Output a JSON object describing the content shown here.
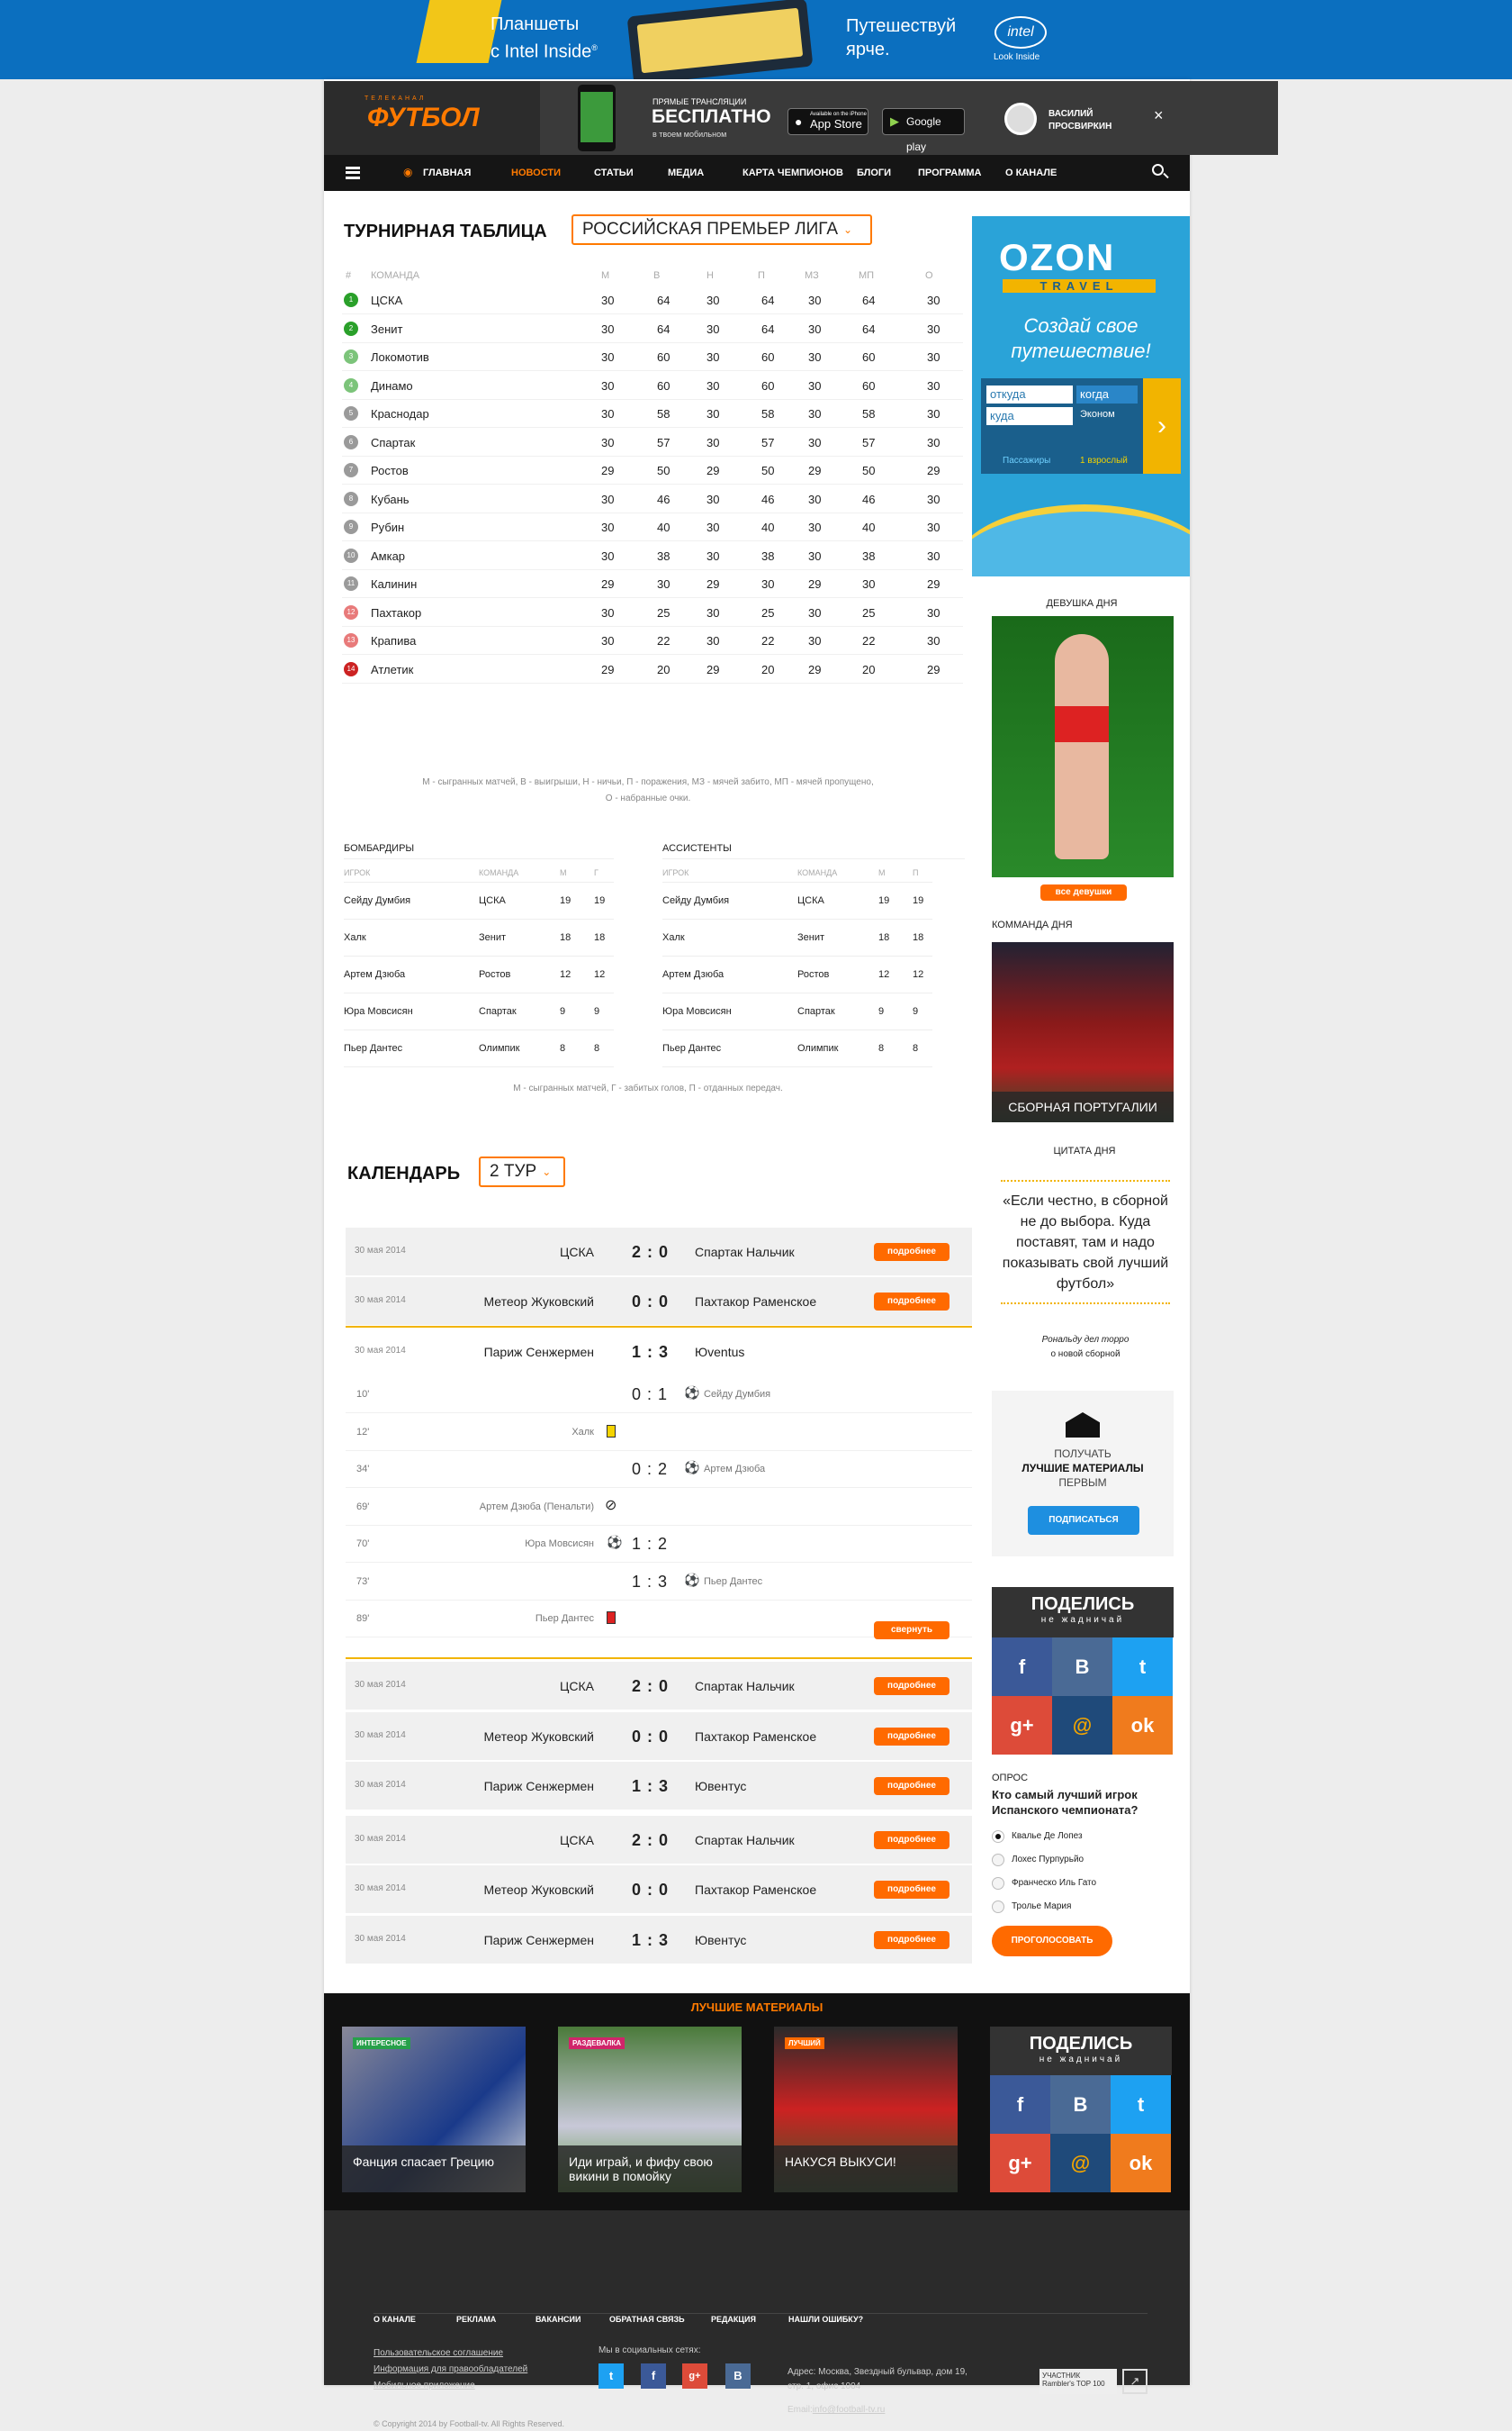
{
  "top_banner": {
    "line1": "Планшеты",
    "line2": "с Intel Inside",
    "slogan1": "Путешествуй",
    "slogan2": "ярче.",
    "brand": "intel",
    "brand_sub": "Look Inside"
  },
  "mobile_banner": {
    "logo_top": "ТЕЛЕКАНАЛ",
    "logo": "ФУТБОЛ",
    "line1": "ПРЯМЫЕ ТРАНСЛЯЦИИ",
    "line2": "БЕСПЛАТНО",
    "line3": "в твоем мобильном",
    "appstore_small": "Available on the iPhone",
    "appstore": "App Store",
    "gplay": "Google play",
    "user_first": "ВАСИЛИЙ",
    "user_last": "ПРОСВИРКИН"
  },
  "nav": {
    "items": [
      "ГЛАВНАЯ",
      "НОВОСТИ",
      "СТАТЬИ",
      "МЕДИА",
      "КАРТА ЧЕМПИОНОВ",
      "БЛОГИ",
      "ПРОГРАММА",
      "О КАНАЛЕ"
    ],
    "active": 1
  },
  "standings": {
    "title": "ТУРНИРНАЯ ТАБЛИЦА",
    "league": "РОССИЙСКАЯ ПРЕМЬЕР ЛИГА",
    "headers": [
      "#",
      "КОМАНДА",
      "М",
      "В",
      "Н",
      "П",
      "МЗ",
      "МП",
      "О"
    ],
    "rows": [
      {
        "n": "1",
        "team": "ЦСКА",
        "v": [
          "30",
          "64",
          "30",
          "64",
          "30",
          "64",
          "30"
        ],
        "c": "#2aa02a"
      },
      {
        "n": "2",
        "team": "Зенит",
        "v": [
          "30",
          "64",
          "30",
          "64",
          "30",
          "64",
          "30"
        ],
        "c": "#2aa02a"
      },
      {
        "n": "3",
        "team": "Локомотив",
        "v": [
          "30",
          "60",
          "30",
          "60",
          "30",
          "60",
          "30"
        ],
        "c": "#7cc47a"
      },
      {
        "n": "4",
        "team": "Динамо",
        "v": [
          "30",
          "60",
          "30",
          "60",
          "30",
          "60",
          "30"
        ],
        "c": "#7cc47a"
      },
      {
        "n": "5",
        "team": "Краснодар",
        "v": [
          "30",
          "58",
          "30",
          "58",
          "30",
          "58",
          "30"
        ],
        "c": "#9a9a9a"
      },
      {
        "n": "6",
        "team": "Спартак",
        "v": [
          "30",
          "57",
          "30",
          "57",
          "30",
          "57",
          "30"
        ],
        "c": "#9a9a9a"
      },
      {
        "n": "7",
        "team": "Ростов",
        "v": [
          "29",
          "50",
          "29",
          "50",
          "29",
          "50",
          "29"
        ],
        "c": "#9a9a9a"
      },
      {
        "n": "8",
        "team": "Кубань",
        "v": [
          "30",
          "46",
          "30",
          "46",
          "30",
          "46",
          "30"
        ],
        "c": "#9a9a9a"
      },
      {
        "n": "9",
        "team": "Рубин",
        "v": [
          "30",
          "40",
          "30",
          "40",
          "30",
          "40",
          "30"
        ],
        "c": "#9a9a9a"
      },
      {
        "n": "10",
        "team": "Амкар",
        "v": [
          "30",
          "38",
          "30",
          "38",
          "30",
          "38",
          "30"
        ],
        "c": "#9a9a9a"
      },
      {
        "n": "11",
        "team": "Калинин",
        "v": [
          "29",
          "30",
          "29",
          "30",
          "29",
          "30",
          "29"
        ],
        "c": "#9a9a9a"
      },
      {
        "n": "12",
        "team": "Пахтакор",
        "v": [
          "30",
          "25",
          "30",
          "25",
          "30",
          "25",
          "30"
        ],
        "c": "#e87a7a"
      },
      {
        "n": "13",
        "team": "Крапива",
        "v": [
          "30",
          "22",
          "30",
          "22",
          "30",
          "22",
          "30"
        ],
        "c": "#e87a7a"
      },
      {
        "n": "14",
        "team": "Атлетик",
        "v": [
          "29",
          "20",
          "29",
          "20",
          "29",
          "20",
          "29"
        ],
        "c": "#cc2222"
      }
    ],
    "note1": "М - сыгранных матчей, В - выигрыши, Н - ничьи, П - поражения, МЗ - мячей забито, МП - мячей пропущено,",
    "note2": "О - набранные очки."
  },
  "scorers": {
    "title": "БОМБАРДИРЫ",
    "headers": [
      "ИГРОК",
      "КОМАНДА",
      "М",
      "Г"
    ],
    "rows": [
      [
        "Сейду Думбия",
        "ЦСКА",
        "19",
        "19"
      ],
      [
        "Халк",
        "Зенит",
        "18",
        "18"
      ],
      [
        "Артем Дзюба",
        "Ростов",
        "12",
        "12"
      ],
      [
        "Юра Мовсисян",
        "Спартак",
        "9",
        "9"
      ],
      [
        "Пьер Дантес",
        "Олимпик",
        "8",
        "8"
      ]
    ]
  },
  "assists": {
    "title": "АССИСТЕНТЫ",
    "headers": [
      "ИГРОК",
      "КОМАНДА",
      "М",
      "П"
    ],
    "rows": [
      [
        "Сейду Думбия",
        "ЦСКА",
        "19",
        "19"
      ],
      [
        "Халк",
        "Зенит",
        "18",
        "18"
      ],
      [
        "Артем Дзюба",
        "Ростов",
        "12",
        "12"
      ],
      [
        "Юра Мовсисян",
        "Спартак",
        "9",
        "9"
      ],
      [
        "Пьер Дантес",
        "Олимпик",
        "8",
        "8"
      ]
    ]
  },
  "scorers_note": "М - сыгранных матчей, Г - забитых голов, П - отданных передач.",
  "calendar": {
    "title": "КАЛЕНДАРЬ",
    "round": "2 ТУР",
    "more": "подробнее",
    "collapse": "свернуть",
    "top": [
      {
        "date": "30 мая 2014",
        "home": "ЦСКА",
        "score": "2 : 0",
        "away": "Спартак Нальчик"
      },
      {
        "date": "30 мая 2014",
        "home": "Метеор Жуковский",
        "score": "0 : 0",
        "away": "Пахтакор Раменское"
      }
    ],
    "open": {
      "date": "30 мая 2014",
      "home": "Париж Сенжермен",
      "score": "1 : 3",
      "away": "Юventus"
    },
    "events": [
      {
        "min": "10'",
        "left": "",
        "score": "0 : 1",
        "right": "Сейду Думбия",
        "icon": "ball-right"
      },
      {
        "min": "12'",
        "left": "Халк",
        "score": "",
        "right": "",
        "icon": "yellow"
      },
      {
        "min": "34'",
        "left": "",
        "score": "0 : 2",
        "right": "Артем Дзюба",
        "icon": "ball-right"
      },
      {
        "min": "69'",
        "left": "Артем Дзюба (Пенальти)",
        "score": "",
        "right": "",
        "icon": "miss"
      },
      {
        "min": "70'",
        "left": "Юра Мовсисян",
        "score": "1 : 2",
        "right": "",
        "icon": "ball-left"
      },
      {
        "min": "73'",
        "left": "",
        "score": "1 : 3",
        "right": "Пьер Дантес",
        "icon": "ball-right"
      },
      {
        "min": "89'",
        "left": "Пьер Дантес",
        "score": "",
        "right": "",
        "icon": "red"
      }
    ],
    "bottom": [
      {
        "date": "30 мая 2014",
        "home": "ЦСКА",
        "score": "2 : 0",
        "away": "Спартак Нальчик"
      },
      {
        "date": "30 мая 2014",
        "home": "Метеор Жуковский",
        "score": "0 : 0",
        "away": "Пахтакор Раменское"
      },
      {
        "date": "30 мая 2014",
        "home": "Париж Сенжермен",
        "score": "1 : 3",
        "away": "Ювентус"
      },
      {
        "date": "30 мая 2014",
        "home": "ЦСКА",
        "score": "2 : 0",
        "away": "Спартак Нальчик"
      },
      {
        "date": "30 мая 2014",
        "home": "Метеор Жуковский",
        "score": "0 : 0",
        "away": "Пахтакор Раменское"
      },
      {
        "date": "30 мая 2014",
        "home": "Париж Сенжермен",
        "score": "1 : 3",
        "away": "Ювентус"
      }
    ]
  },
  "ozon": {
    "brand": "OZON",
    "sub": "TRAVEL",
    "slogan1": "Создай свое",
    "slogan2": "путешествие!",
    "from": "откуда",
    "when": "когда",
    "to": "куда",
    "cls": "Эконом",
    "pass": "Пассажиры",
    "adults": "1 взрослый"
  },
  "girl": {
    "title": "ДЕВУШКА ДНЯ",
    "button": "все девушки"
  },
  "team_day": {
    "title": "КОММАНДА ДНЯ",
    "caption": "СБОРНАЯ ПОРТУГАЛИИ"
  },
  "quote": {
    "title": "ЦИТАТА ДНЯ",
    "text": "«Если честно, в сборной не до выбора. Куда поставят, там и надо показывать свой лучший футбол»",
    "author": "Рональду дел торро",
    "about": "о новой сборной"
  },
  "subscribe": {
    "l1": "ПОЛУЧАТЬ",
    "l2": "ЛУЧШИЕ МАТЕРИАЛЫ",
    "l3": "ПЕРВЫМ",
    "button": "ПОДПИСАТЬСЯ"
  },
  "share": {
    "title": "ПОДЕЛИСЬ",
    "sub": "не жадничай"
  },
  "poll": {
    "title": "ОПРОС",
    "question": "Кто самый лучший игрок Испанского чемпионата?",
    "options": [
      "Квальe Де Лопез",
      "Лохес Пурпурьйо",
      "Франческо Иль Гато",
      "Тролье Мария"
    ],
    "button": "ПРОГОЛОСОВАТЬ"
  },
  "best": {
    "title": "ЛУЧШИЕ МАТЕРИАЛЫ",
    "cards": [
      {
        "tag": "ИНТЕРЕСНОЕ",
        "caption": "Фанция спасает Грецию",
        "c": "#27a04a"
      },
      {
        "tag": "РАЗДЕВАЛКА",
        "caption": "Иди играй, и фифу свою викини в помойку",
        "c": "#d0256a"
      },
      {
        "tag": "ЛУЧШИЙ",
        "caption": "НАКУСЯ ВЫКУСИ!",
        "c": "#ff6a00"
      }
    ]
  },
  "footer": {
    "links": [
      "О КАНАЛЕ",
      "РЕКЛАМА",
      "ВАКАНСИИ",
      "ОБРАТНАЯ СВЯЗЬ",
      "РЕДАКЦИЯ",
      "НАШЛИ ОШИБКУ?"
    ],
    "legal": [
      "Пользовательское соглашение",
      "Информация для правообладателей",
      "Мобильное приложение"
    ],
    "social_title": "Мы в социальных сетях:",
    "address1": "Адрес: Москва, Звездный бульвар, дом 19,",
    "address2": "стр. 1, офис 1004",
    "email_label": "Email:",
    "email": "info@football-tv.ru",
    "copyright": "© Copyright 2014 by Football-tv. All Rights Reserved.",
    "rambler": "УЧАСТНИК Rambler's TOP 100"
  }
}
